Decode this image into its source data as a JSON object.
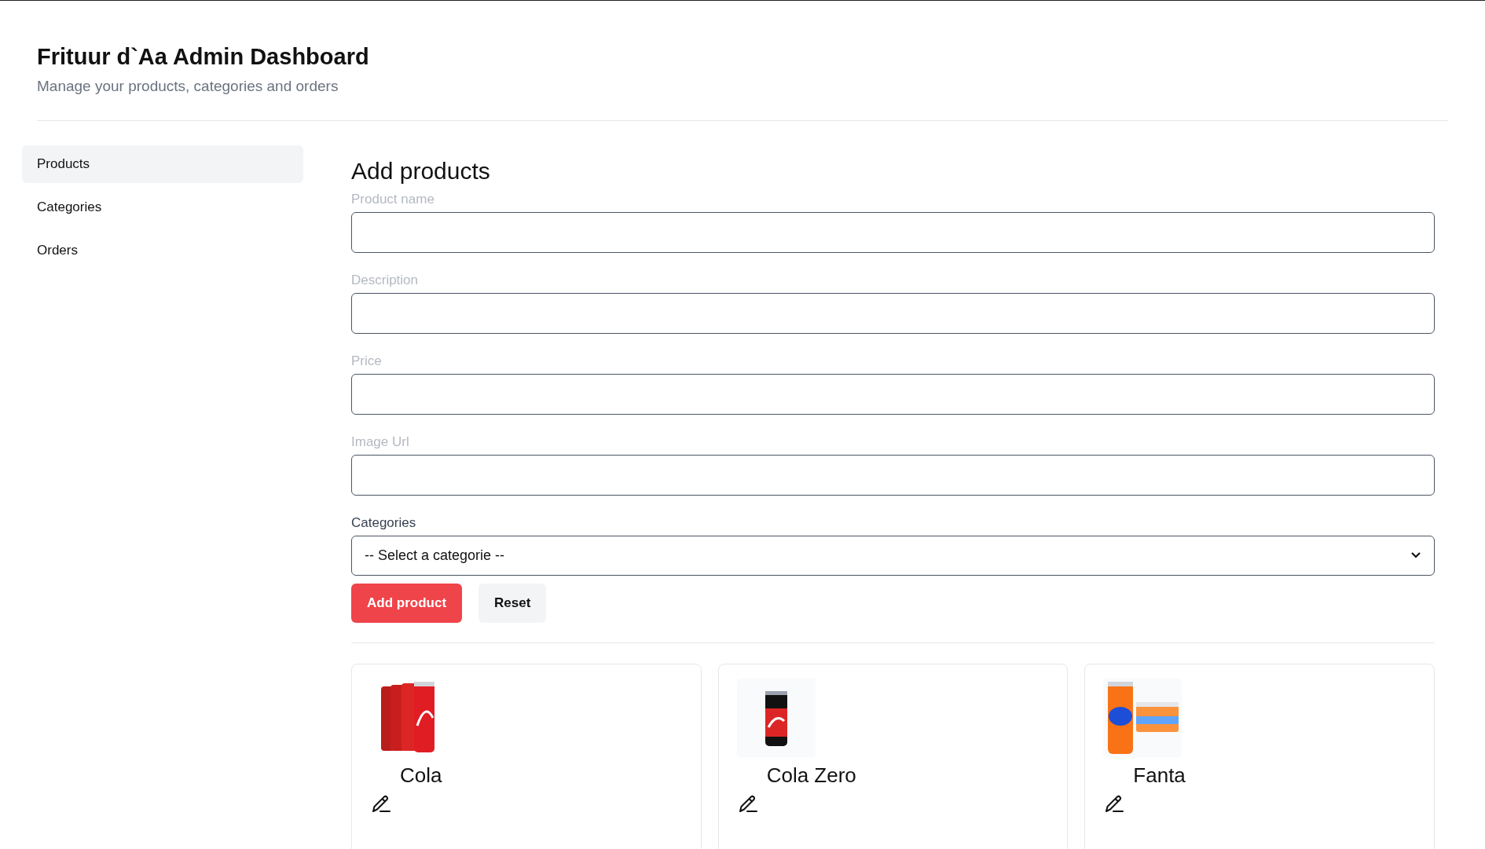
{
  "header": {
    "title": "Frituur d`Aa Admin Dashboard",
    "subtitle": "Manage your products, categories and orders"
  },
  "sidebar": {
    "items": [
      {
        "label": "Products",
        "selected": true
      },
      {
        "label": "Categories",
        "selected": false
      },
      {
        "label": "Orders",
        "selected": false
      }
    ]
  },
  "form": {
    "heading": "Add products",
    "fields": [
      {
        "label": "Product name",
        "kind": "text"
      },
      {
        "label": "Description",
        "kind": "text"
      },
      {
        "label": "Price",
        "kind": "text"
      },
      {
        "label": "Image Url",
        "kind": "text"
      },
      {
        "label": "Categories",
        "kind": "select",
        "value": "-- Select a categorie --"
      }
    ],
    "buttons": [
      {
        "label": "Add product",
        "kind": "primary"
      },
      {
        "label": "Reset",
        "kind": "secondary"
      }
    ]
  },
  "products": [
    {
      "name": "Cola"
    },
    {
      "name": "Cola Zero"
    },
    {
      "name": "Fanta"
    }
  ]
}
